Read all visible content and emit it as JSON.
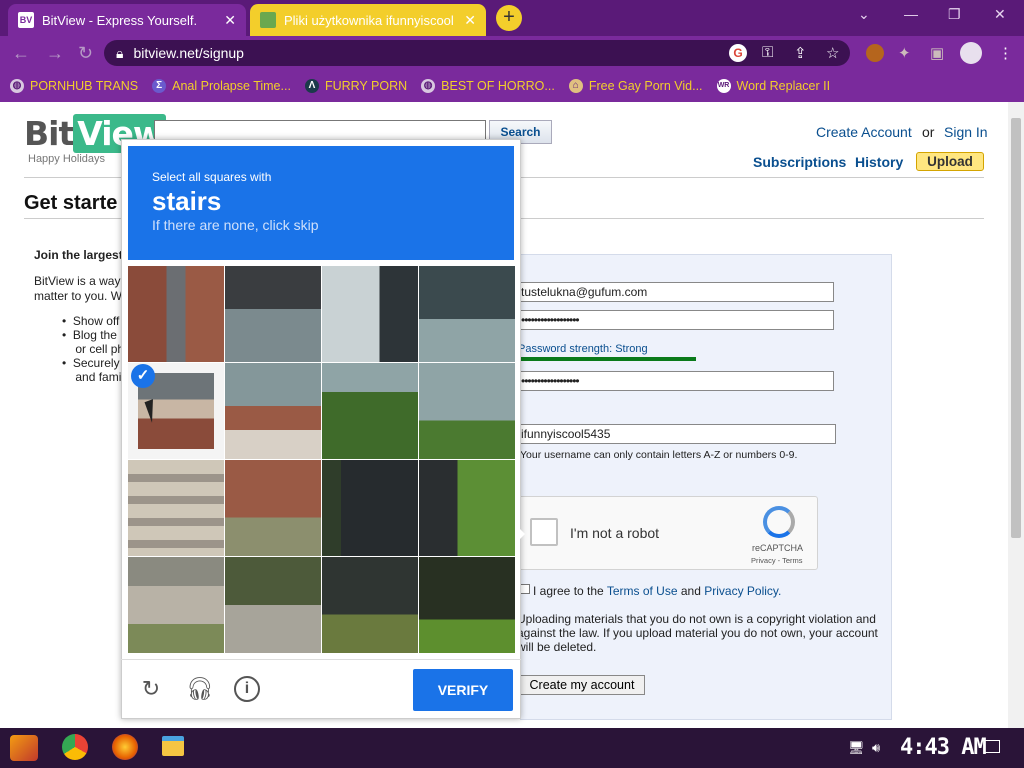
{
  "browser": {
    "tabs": [
      {
        "label": "BitView - Express Yourself.",
        "close": "✕",
        "favicon_color": "#ffffff"
      },
      {
        "label": "Pliki użytkownika ifunnyiscool -",
        "close": "✕",
        "favicon_color": "#6aa84f"
      }
    ],
    "new_tab": "+",
    "url": "bitview.net/signup",
    "bookmarks": [
      {
        "label": "PORNHUB TRANS",
        "icon": "globe-icon"
      },
      {
        "label": "Anal Prolapse Time...",
        "icon": "sigma-icon"
      },
      {
        "label": "FURRY PORN",
        "icon": "lambda-icon"
      },
      {
        "label": "BEST OF HORRO...",
        "icon": "globe-icon"
      },
      {
        "label": "Free Gay Porn Vid...",
        "icon": "tag-icon"
      },
      {
        "label": "Word Replacer II",
        "icon": "wr-icon"
      }
    ],
    "accent_color": "#7a2a9c",
    "tab_accent": "#f3ce2b"
  },
  "site": {
    "logo_bit": "Bit",
    "logo_view": "View",
    "tagline": "Happy Holidays",
    "search_button": "Search",
    "create_account": "Create Account",
    "or": "or",
    "sign_in": "Sign In",
    "nav": [
      "Subscriptions",
      "History"
    ],
    "upload": "Upload",
    "heading": "Get starte",
    "intro_title": "Join the largest",
    "intro_text_1": "BitView is a way",
    "intro_text_2": "matter to you. W",
    "bullets": [
      "Show off",
      "Blog the",
      "or cell ph",
      "Securely",
      "and fami"
    ]
  },
  "form": {
    "email": "tustelukna@gufum.com",
    "password_mask": "••••••••••••••••••",
    "password_strength": "Password strength: Strong",
    "confirm_mask": "••••••••••••••••••",
    "username": "ifunnyiscool5435",
    "username_hint": "Your username can only contain letters A-Z or numbers 0-9.",
    "recaptcha_label": "I'm not a robot",
    "recaptcha_brand": "reCAPTCHA",
    "recaptcha_links": "Privacy - Terms",
    "agree_prefix": "I agree to the",
    "terms": "Terms of Use",
    "and": "and",
    "privacy": "Privacy Policy.",
    "warning": "Uploading materials that you do not own is a copyright violation and against the law. If you upload material you do not own, your account will be deleted.",
    "submit": "Create my account"
  },
  "captcha": {
    "instruction": "Select all squares with",
    "target": "stairs",
    "sub": "If there are none, click skip",
    "verify": "VERIFY",
    "selected_tiles": [
      4
    ],
    "accent": "#1a73e8"
  },
  "taskbar": {
    "clock": "4:43 AM"
  }
}
